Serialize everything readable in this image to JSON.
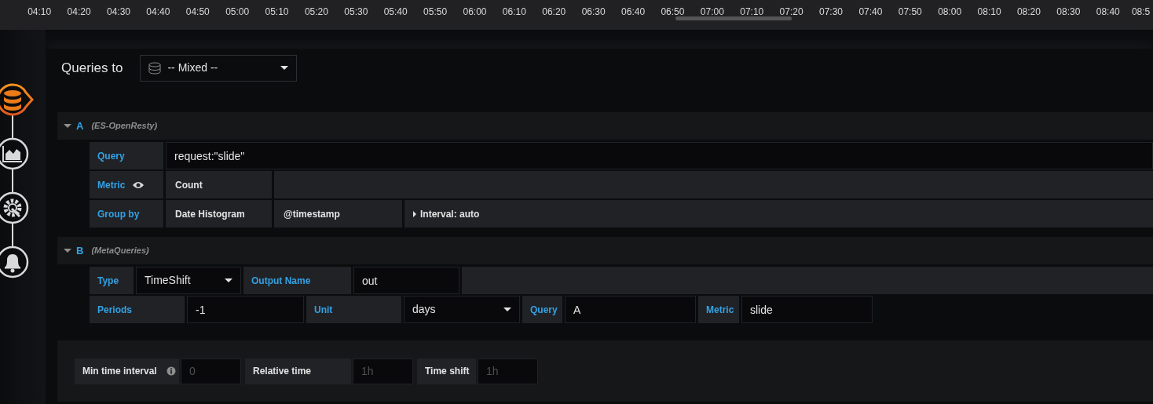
{
  "axis": {
    "ticks": [
      "04:10",
      "04:20",
      "04:30",
      "04:40",
      "04:50",
      "05:00",
      "05:10",
      "05:20",
      "05:30",
      "05:40",
      "05:50",
      "06:00",
      "06:10",
      "06:20",
      "06:30",
      "06:40",
      "06:50",
      "07:00",
      "07:10",
      "07:20",
      "07:30",
      "07:40",
      "07:50",
      "08:00",
      "08:10",
      "08:20",
      "08:30",
      "08:40",
      "08:5"
    ]
  },
  "sidebar": {
    "steps": [
      {
        "kind": "database",
        "selected": true
      },
      {
        "kind": "chart",
        "selected": false
      },
      {
        "kind": "settings",
        "selected": false
      },
      {
        "kind": "alert",
        "selected": false
      }
    ]
  },
  "datasource": {
    "label": "Queries to",
    "value": "-- Mixed --"
  },
  "queries": [
    {
      "ref": "A",
      "datasource": "(ES-OpenResty)",
      "expanded": true,
      "rows": [
        {
          "cells": [
            {
              "kind": "label",
              "text": "Query"
            },
            {
              "kind": "input",
              "value": "request:\"slide\""
            }
          ]
        },
        {
          "cells": [
            {
              "kind": "label_eye",
              "text": "Metric"
            },
            {
              "kind": "text",
              "text": "Count"
            },
            {
              "kind": "filler"
            }
          ]
        },
        {
          "cells": [
            {
              "kind": "label",
              "text": "Group by"
            },
            {
              "kind": "text",
              "text": "Date Histogram"
            },
            {
              "kind": "text",
              "text": "@timestamp"
            },
            {
              "kind": "expander",
              "text": "Interval: auto",
              "expanded": false
            }
          ]
        }
      ]
    },
    {
      "ref": "B",
      "datasource": "(MetaQueries)",
      "expanded": true,
      "rows": [
        {
          "cells": [
            {
              "kind": "label",
              "text": "Type"
            },
            {
              "kind": "select",
              "value": "TimeShift"
            },
            {
              "kind": "label",
              "text": "Output Name"
            },
            {
              "kind": "input",
              "value": "out"
            },
            {
              "kind": "filler"
            }
          ]
        },
        {
          "cells": [
            {
              "kind": "label",
              "text": "Periods"
            },
            {
              "kind": "input",
              "value": "-1"
            },
            {
              "kind": "label",
              "text": "Unit"
            },
            {
              "kind": "select",
              "value": "days"
            },
            {
              "kind": "label",
              "text": "Query"
            },
            {
              "kind": "input",
              "value": "A"
            },
            {
              "kind": "label",
              "text": "Metric"
            },
            {
              "kind": "input",
              "value": "slide"
            }
          ]
        }
      ]
    }
  ],
  "options": [
    {
      "label": "Min time interval",
      "info": true,
      "placeholder": "0"
    },
    {
      "label": "Relative time",
      "info": false,
      "placeholder": "1h"
    },
    {
      "label": "Time shift",
      "info": false,
      "placeholder": "1h"
    }
  ]
}
